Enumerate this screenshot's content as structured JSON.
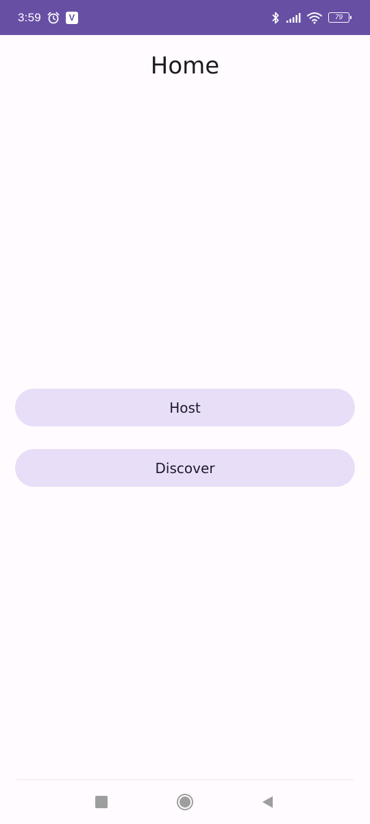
{
  "status_bar": {
    "time": "3:59",
    "app_badge": "V",
    "battery_level": "79",
    "icons": [
      "alarm-icon",
      "app-v-icon",
      "bluetooth-icon",
      "signal-icon",
      "wifi-icon",
      "battery-icon"
    ]
  },
  "header": {
    "title": "Home"
  },
  "actions": {
    "host_label": "Host",
    "discover_label": "Discover"
  },
  "nav_bar": {
    "buttons": [
      "recent-apps",
      "home",
      "back"
    ]
  },
  "colors": {
    "status_bar": "#6750a4",
    "background": "#fffbfe",
    "button_bg": "#e8def8",
    "button_text": "#1d192b"
  }
}
